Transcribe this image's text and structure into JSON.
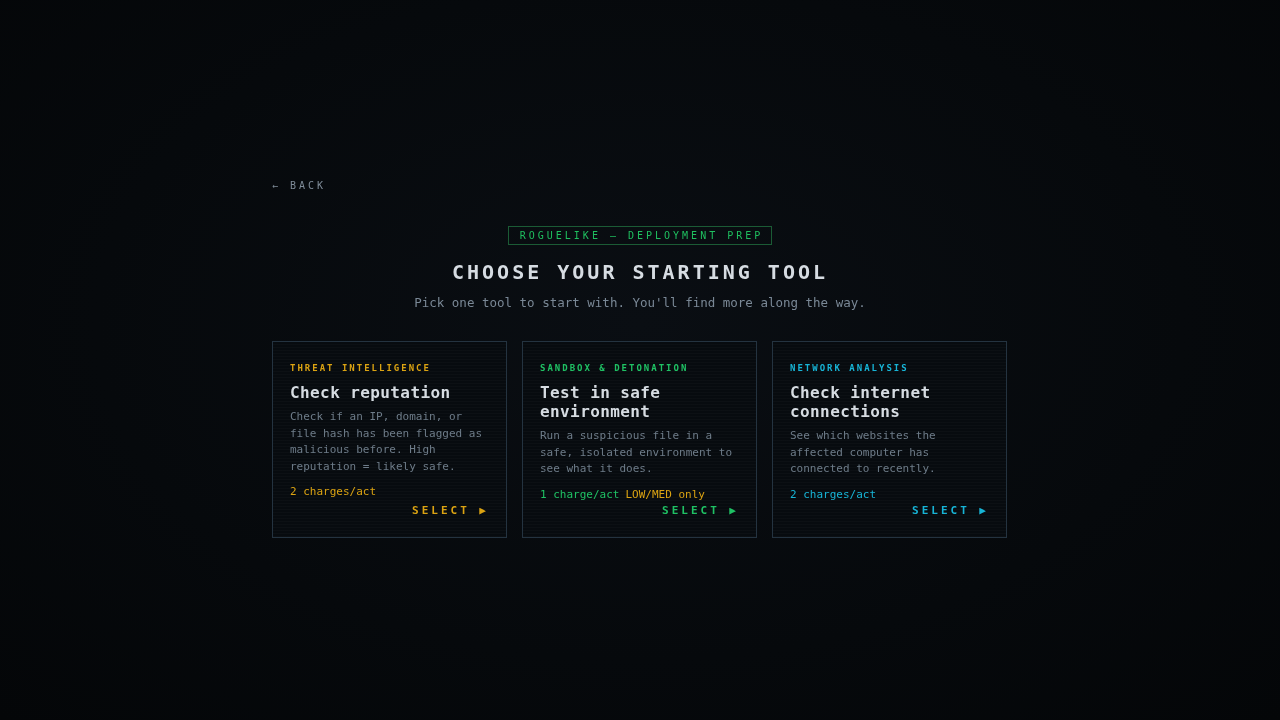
{
  "back_link": "← BACK",
  "badge": "ROGUELIKE — DEPLOYMENT PREP",
  "title": "CHOOSE YOUR STARTING TOOL",
  "subtitle": "Pick one tool to start with. You'll find more along the way.",
  "tools": [
    {
      "category": "THREAT INTELLIGENCE",
      "name": "Check reputation",
      "description": "Check if an IP, domain, or file hash has been flagged as malicious before. High reputation = likely safe.",
      "charges": "2 charges/act",
      "color": "#dba312",
      "select": "SELECT ▶"
    },
    {
      "category": "SANDBOX & DETONATION",
      "name": "Test in safe environment",
      "description": "Run a suspicious file in a safe, isolated environment to see what it does.",
      "charges": "1 charge/act",
      "restriction": "LOW/MED only",
      "color": "#1fc164",
      "select": "SELECT ▶"
    },
    {
      "category": "NETWORK ANALYSIS",
      "name": "Check internet connections",
      "description": "See which websites the affected computer has connected to recently.",
      "charges": "2 charges/act",
      "color": "#17b4d6",
      "select": "SELECT ▶"
    }
  ]
}
